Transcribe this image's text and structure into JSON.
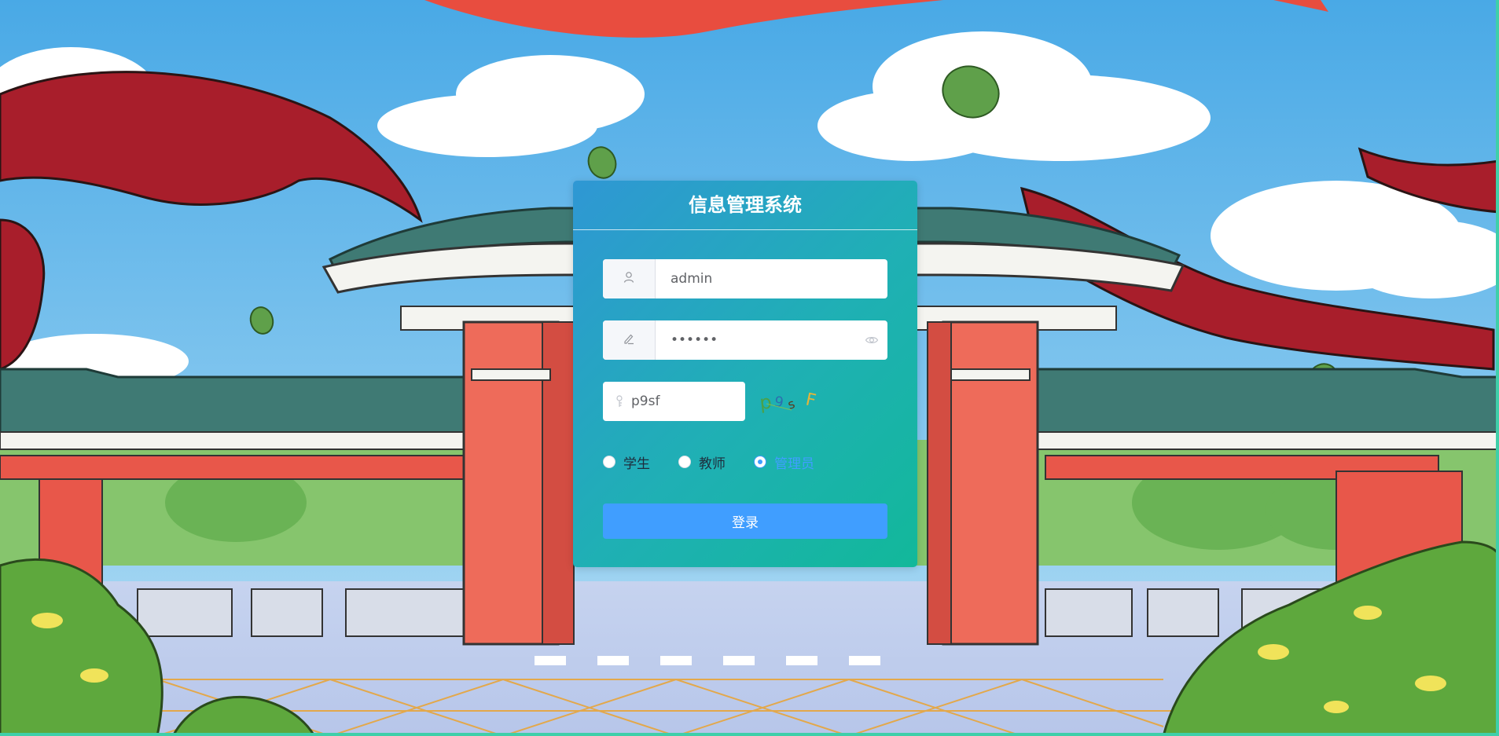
{
  "card": {
    "title": "信息管理系统"
  },
  "form": {
    "username": {
      "value": "admin",
      "icon": "user-icon"
    },
    "password": {
      "value": "••••••",
      "icon": "edit-icon",
      "suffix_icon": "eye-icon"
    },
    "captcha": {
      "value": "p9sf",
      "icon": "key-icon",
      "image_text": "p9sF"
    }
  },
  "roles": [
    {
      "label": "学生",
      "checked": false
    },
    {
      "label": "教师",
      "checked": false
    },
    {
      "label": "管理员",
      "checked": true
    }
  ],
  "login_button": {
    "label": "登录"
  },
  "colors": {
    "accent": "#409eff",
    "card_gradient_start": "#2f97d4",
    "card_gradient_end": "#12b89a"
  }
}
